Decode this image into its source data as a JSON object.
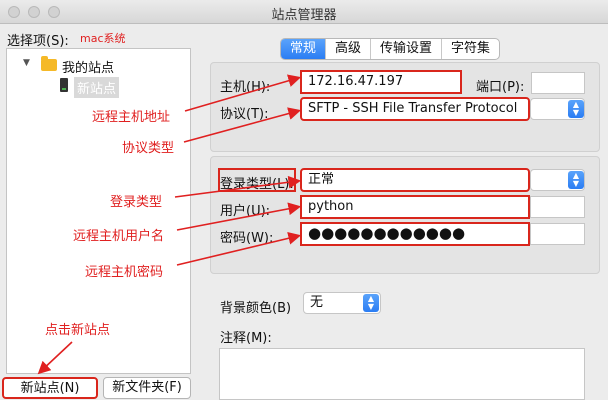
{
  "window": {
    "title": "站点管理器"
  },
  "select_label": "选择项(S):",
  "select_note": "mac系统",
  "tree": {
    "root": "我的站点",
    "new_site": "新站点"
  },
  "buttons": {
    "new_site": "新站点(N)",
    "new_folder": "新文件夹(F)"
  },
  "tabs": [
    "常规",
    "高级",
    "传输设置",
    "字符集"
  ],
  "form": {
    "host_label": "主机(H):",
    "host_value": "172.16.47.197",
    "port_label": "端口(P):",
    "port_value": "",
    "protocol_label": "协议(T):",
    "protocol_value": "SFTP - SSH File Transfer Protocol",
    "login_type_label": "登录类型(L):",
    "login_type_value": "正常",
    "user_label": "用户(U):",
    "user_value": "python",
    "password_label": "密码(W):",
    "password_value": "●●●●●●●●●●●●",
    "bg_color_label": "背景颜色(B)",
    "bg_color_value": "无",
    "comment_label": "注释(M):"
  },
  "annotations": {
    "host": "远程主机地址",
    "protocol": "协议类型",
    "login_type": "登录类型",
    "user": "远程主机用户名",
    "password": "远程主机密码",
    "new_site": "点击新站点"
  },
  "colors": {
    "annotation": "#e02020",
    "accent": "#2b7df3"
  }
}
